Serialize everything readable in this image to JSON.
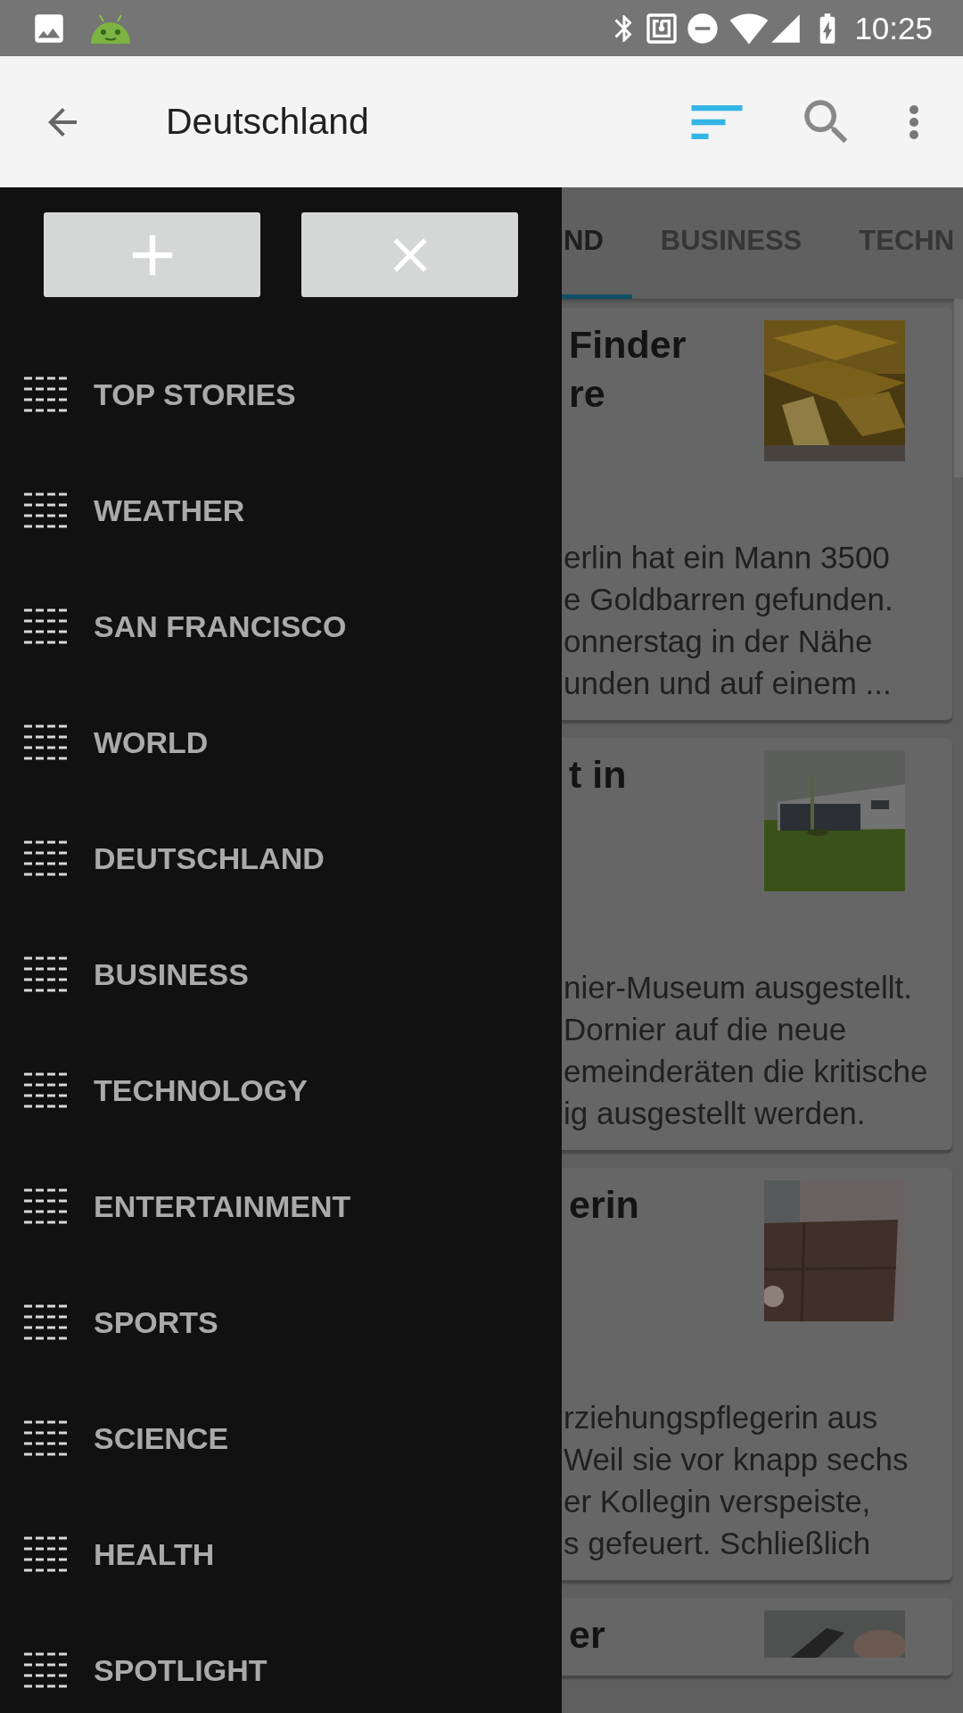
{
  "status_bar": {
    "time": "10:25"
  },
  "toolbar": {
    "title": "Deutschland"
  },
  "drawer": {
    "items": [
      {
        "label": "TOP STORIES"
      },
      {
        "label": "WEATHER"
      },
      {
        "label": "SAN FRANCISCO"
      },
      {
        "label": "WORLD"
      },
      {
        "label": "DEUTSCHLAND"
      },
      {
        "label": "BUSINESS"
      },
      {
        "label": "TECHNOLOGY"
      },
      {
        "label": "ENTERTAINMENT"
      },
      {
        "label": "SPORTS"
      },
      {
        "label": "SCIENCE"
      },
      {
        "label": "HEALTH"
      },
      {
        "label": "SPOTLIGHT"
      }
    ]
  },
  "tabs": [
    {
      "label": "ND",
      "selected": true
    },
    {
      "label": "BUSINESS",
      "selected": false
    },
    {
      "label": "TECHN",
      "selected": false
    }
  ],
  "articles": [
    {
      "title_lines": [
        "Finder",
        "re"
      ],
      "body_lines": [
        "erlin hat ein Mann 3500",
        "e Goldbarren gefunden.",
        "onnerstag in der Nähe",
        "unden und auf einem ..."
      ]
    },
    {
      "title_lines": [
        "t in"
      ],
      "body_lines": [
        "nier-Museum ausgestellt.",
        "Dornier auf die neue",
        "emeinderäten die kritische",
        "ig ausgestellt werden."
      ]
    },
    {
      "title_lines": [
        "erin"
      ],
      "body_lines": [
        "rziehungspflegerin aus",
        "Weil sie vor knapp sechs",
        "er Kollegin verspeiste,",
        "s gefeuert. Schließlich"
      ]
    },
    {
      "title_lines": [
        "er"
      ]
    }
  ]
}
